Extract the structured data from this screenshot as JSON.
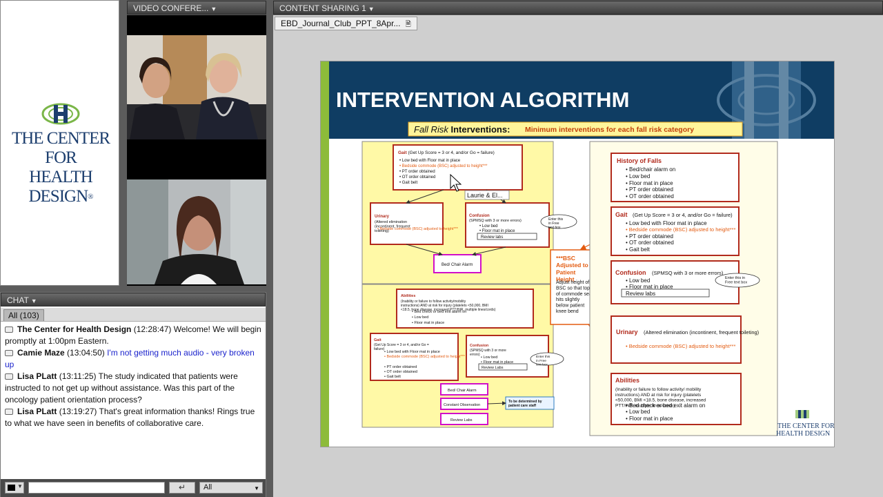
{
  "logo": {
    "line1": "THE CENTER FOR",
    "line2": "HEALTH DESIGN",
    "reg": "®"
  },
  "video_pod": {
    "title": "VIDEO CONFERE..."
  },
  "content_pod": {
    "title": "CONTENT SHARING 1",
    "file_tab": "EBD_Journal_Club_PPT_8Apr..."
  },
  "chat": {
    "title": "CHAT",
    "tab": "All (103)",
    "messages": [
      {
        "author": "The Center for Health Design",
        "time": "(12:28:47)",
        "text": "Welcome! We will begin promptly at 1:00pm Eastern."
      },
      {
        "author": "Camie Maze",
        "time": "(13:04:50)",
        "text": "I'm not getting much audio - very broken up"
      },
      {
        "author": "Lisa PLatt",
        "time": "(13:11:25)",
        "text": "The study indicated that patients were instructed to not get up without assistance.  Was this part of the oncology patient orientation process?"
      },
      {
        "author": "Lisa PLatt",
        "time": "(13:19:27)",
        "text": "That's great information thanks! Rings true to what we have seen in benefits of collaborative care."
      }
    ],
    "input_placeholder": "",
    "send_icon": "↵",
    "recipient": "All"
  },
  "slide": {
    "title": "INTERVENTION ALGORITHM",
    "subtitle_italic": "Fall Risk",
    "subtitle_bold": "Interventions:",
    "subtitle_note": "Minimum interventions for each fall risk category",
    "cursor_label": "Laurie & El...",
    "footer_logo_1": "THE CENTER FOR",
    "footer_logo_2": "HEALTH DESIGN",
    "left": {
      "gait_head": "Gait",
      "gait_desc": "(Get Up Score = 3 or 4, and/or Go = failure)",
      "gait_items": [
        "Low bed with Floor mat in place",
        "Bedside commode (BSC) adjusted to height***",
        "PT order obtained",
        "OT order obtained",
        "Gait belt"
      ],
      "urinary_head": "Urinary",
      "urinary_desc": "(Altered elimination (incontinent, frequent toileting)",
      "urinary_items": [
        "Bedside commode (BSC) adjusted to height***"
      ],
      "confusion_head": "Confusion",
      "confusion_desc": "(SPMSQ with 3 or more errors)",
      "confusion_items": [
        "Low bed",
        "Floor mat in place"
      ],
      "review_labs": "Review labs",
      "enter_note": "Enter this in Free text box",
      "bed_alarm": "Bed/ Chair Alarm",
      "abilities_head": "Abilities",
      "abilities_desc": "(Inability or failure to follow activity/mobility instructions) AND at risk for injury (platelets <50,000, BMI <18.5, bone disease, increased PTT/INR, multiple lines/cords)",
      "abilities_items": [
        "Bed check or bed exit alarm on",
        "Low bed",
        "Floor mat in place"
      ],
      "gait2_desc": "(Get Up Score = 3 or 4, and/or Go = failure)",
      "gait2_items": [
        "Low bed with Floor mat in place",
        "Bedside commode (BSC) adjusted to height***",
        "PT order obtained",
        "OT order obtained",
        "Gait belt"
      ],
      "confusion2_desc": "(SPMSQ with 3 or more errors)",
      "confusion2_items": [
        "Low bed",
        "Floor mat in place"
      ],
      "bed_alarm2": "Bed/ Chair Alarm",
      "constant_obs": "Constant Observation",
      "review_labs2": "Review Labs",
      "tbd": "To be determined by patient care staff"
    },
    "center": {
      "bsc_head": "***BSC Adjusted to Patient Height",
      "bsc_item": "Adjust height of BSC so that top of commode seat hits slightly below patient knee bend"
    },
    "right": {
      "history_head": "History of Falls",
      "history_items": [
        "Bed/chair alarm on",
        "Low bed",
        "Floor mat in place",
        "PT order obtained",
        "OT order obtained"
      ],
      "gait_head": "Gait",
      "gait_desc": "(Get Up Score = 3 or 4, and/or Go = failure)",
      "gait_items": [
        "Low bed with Floor mat in place",
        "Bedside commode (BSC) adjusted to height***",
        "PT order obtained",
        "OT order obtained",
        "Gait belt"
      ],
      "confusion_head": "Confusion",
      "confusion_desc": "(SPMSQ with 3 or more errors)",
      "confusion_items": [
        "Low bed",
        "Floor mat in place"
      ],
      "review_labs": "Review labs",
      "enter_note": "Enter this in Free text box",
      "urinary_head": "Urinary",
      "urinary_desc": "(Altered elimination (incontinent, frequent toileting)",
      "urinary_items": [
        "Bedside commode (BSC) adjusted to height***"
      ],
      "abilities_head": "Abilities",
      "abilities_desc": "(Inability or failure to follow activity/ mobility instructions) AND at risk for injury (platelets <50,000, BMI <18.5, bone disease, increased PTT/INR, multiple lines/cords)",
      "abilities_items": [
        "Bed check or bed exit alarm on",
        "Low bed",
        "Floor mat in place"
      ]
    }
  },
  "colors": {
    "slide_blue": "#0f3d63",
    "slide_green": "#8dbb3a",
    "box_red": "#b12a1c",
    "orange": "#e35b10",
    "flow_yellow": "#fff9a6",
    "chat_blue": "#1a22cc"
  }
}
